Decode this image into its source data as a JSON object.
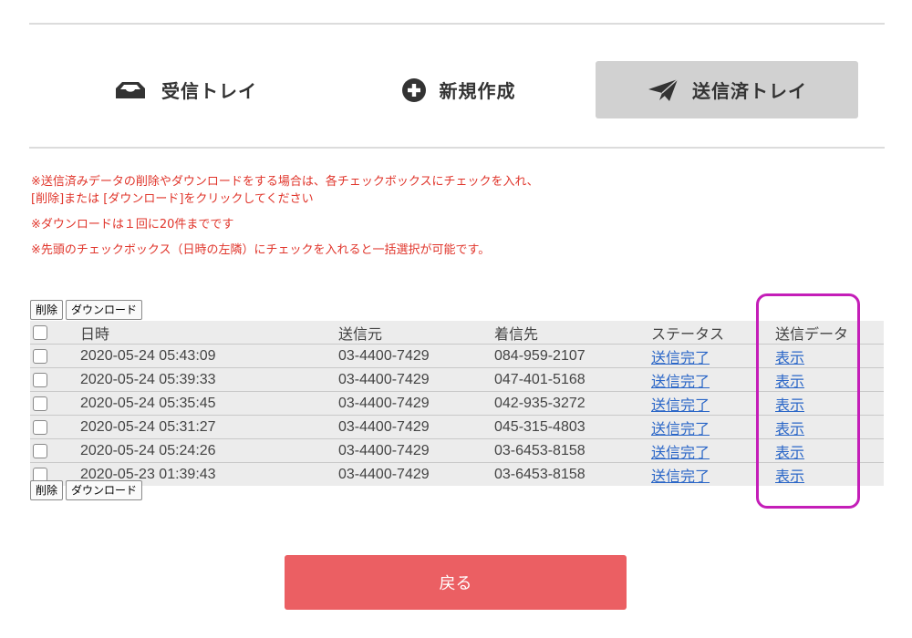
{
  "tabs": [
    {
      "label": "受信トレイ",
      "icon": "inbox-icon",
      "active": false
    },
    {
      "label": "新規作成",
      "icon": "plus-circle-icon",
      "active": false
    },
    {
      "label": "送信済トレイ",
      "icon": "paper-plane-icon",
      "active": true
    }
  ],
  "notes": {
    "line1a": "※送信済みデータの削除やダウンロードをする場合は、各チェックボックスにチェックを入れ、",
    "line1b": "[削除]または [ダウンロード]をクリックしてください",
    "line2": "※ダウンロードは１回に20件までです",
    "line3": "※先頭のチェックボックス（日時の左隣）にチェックを入れると一括選択が可能です。"
  },
  "actions": {
    "delete_label": "削除",
    "download_label": "ダウンロード"
  },
  "table": {
    "headers": [
      "日時",
      "送信元",
      "着信先",
      "ステータス",
      "送信データ"
    ],
    "rows": [
      {
        "datetime": "2020-05-24 05:43:09",
        "from": "03-4400-7429",
        "to": "084-959-2107",
        "status": "送信完了",
        "data": "表示"
      },
      {
        "datetime": "2020-05-24 05:39:33",
        "from": "03-4400-7429",
        "to": "047-401-5168",
        "status": "送信完了",
        "data": "表示"
      },
      {
        "datetime": "2020-05-24 05:35:45",
        "from": "03-4400-7429",
        "to": "042-935-3272",
        "status": "送信完了",
        "data": "表示"
      },
      {
        "datetime": "2020-05-24 05:31:27",
        "from": "03-4400-7429",
        "to": "045-315-4803",
        "status": "送信完了",
        "data": "表示"
      },
      {
        "datetime": "2020-05-24 05:24:26",
        "from": "03-4400-7429",
        "to": "03-6453-8158",
        "status": "送信完了",
        "data": "表示"
      },
      {
        "datetime": "2020-05-23 01:39:43",
        "from": "03-4400-7429",
        "to": "03-6453-8158",
        "status": "送信完了",
        "data": "表示"
      }
    ]
  },
  "back_label": "戻る",
  "colors": {
    "notice": "#e0352b",
    "link": "#2a66c7",
    "back_button": "#eb5f63",
    "active_tab": "#d1d1d1",
    "highlight": "#c41eb8"
  }
}
